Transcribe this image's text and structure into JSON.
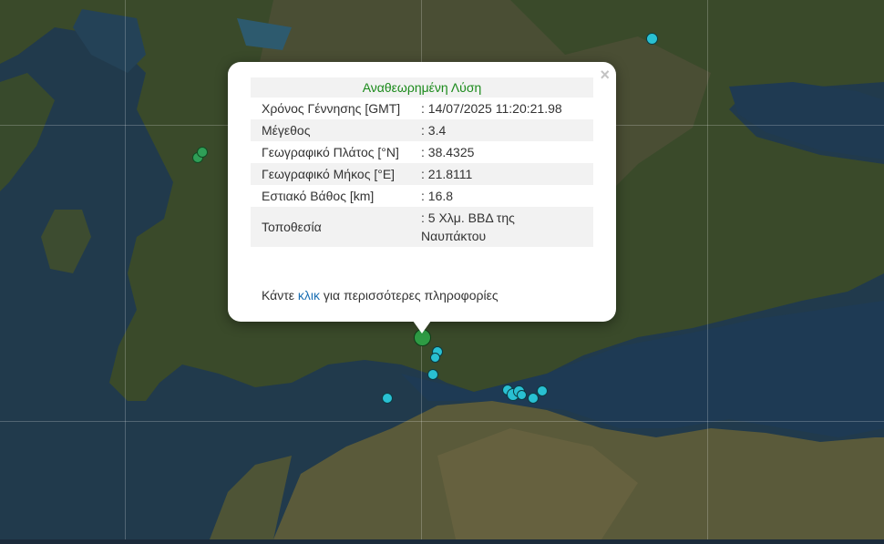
{
  "popup": {
    "title": "Αναθεωρημένη Λύση",
    "close_glyph": "×",
    "rows": [
      {
        "label": "Χρόνος Γέννησης [GMT]",
        "value": ": 14/07/2025 11:20:21.98"
      },
      {
        "label": "Μέγεθος",
        "value": ": 3.4"
      },
      {
        "label": "Γεωγραφικό Πλάτος [°N]",
        "value": ": 38.4325"
      },
      {
        "label": "Γεωγραφικό Μήκος [°E]",
        "value": ": 21.8111"
      },
      {
        "label": "Εστιακό Βάθος [km]",
        "value": ": 16.8"
      },
      {
        "label": "Τοποθεσία",
        "value": ": 5 Χλμ. ΒΒΔ της Ναυπάκτου"
      }
    ],
    "more_prefix": "Κάντε ",
    "more_link": "κλικ",
    "more_suffix": " για περισσότερες πληροφορίες"
  },
  "colors": {
    "event_recent": "#2e9b44",
    "event_older": "#29c0d2",
    "event_green": "#2f9e57",
    "title_green": "#1a8a1a",
    "link_blue": "#1b6fb3"
  }
}
